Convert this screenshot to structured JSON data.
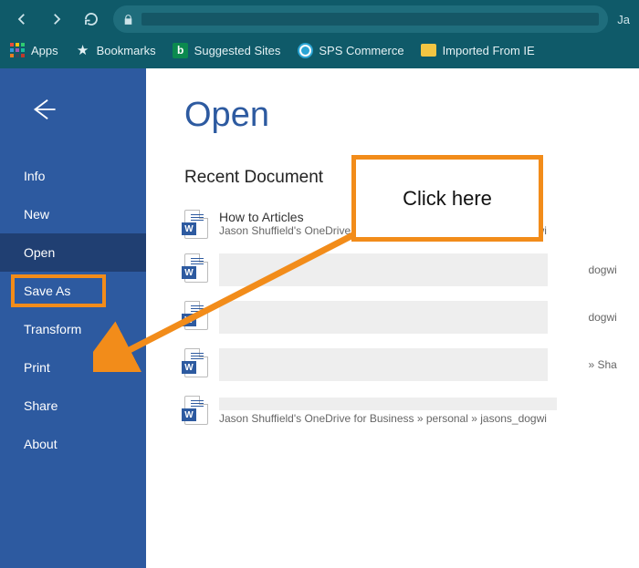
{
  "browser": {
    "url_trail": "Ja",
    "bookmarks": [
      {
        "icon": "apps",
        "label": "Apps"
      },
      {
        "icon": "star",
        "label": "Bookmarks"
      },
      {
        "icon": "bing",
        "label": "Suggested Sites"
      },
      {
        "icon": "sps",
        "label": "SPS Commerce"
      },
      {
        "icon": "folder",
        "label": "Imported From IE"
      }
    ]
  },
  "sidebar": {
    "items": [
      {
        "label": "Info"
      },
      {
        "label": "New"
      },
      {
        "label": "Open"
      },
      {
        "label": "Save As"
      },
      {
        "label": "Transform"
      },
      {
        "label": "Print"
      },
      {
        "label": "Share"
      },
      {
        "label": "About"
      }
    ]
  },
  "main": {
    "title": "Open",
    "section": "Recent Document",
    "docs": [
      {
        "title": "How to Articles",
        "path": "Jason Shuffield's OneDrive for Business » personal » jasons_dogwi"
      },
      {
        "title": "",
        "path": "dogwi"
      },
      {
        "title": "",
        "path": "dogwi"
      },
      {
        "title": "",
        "path": "» Sha"
      },
      {
        "title": "",
        "path": "Jason Shuffield's OneDrive for Business » personal » jasons_dogwi"
      }
    ]
  },
  "callout": {
    "text": "Click here"
  }
}
